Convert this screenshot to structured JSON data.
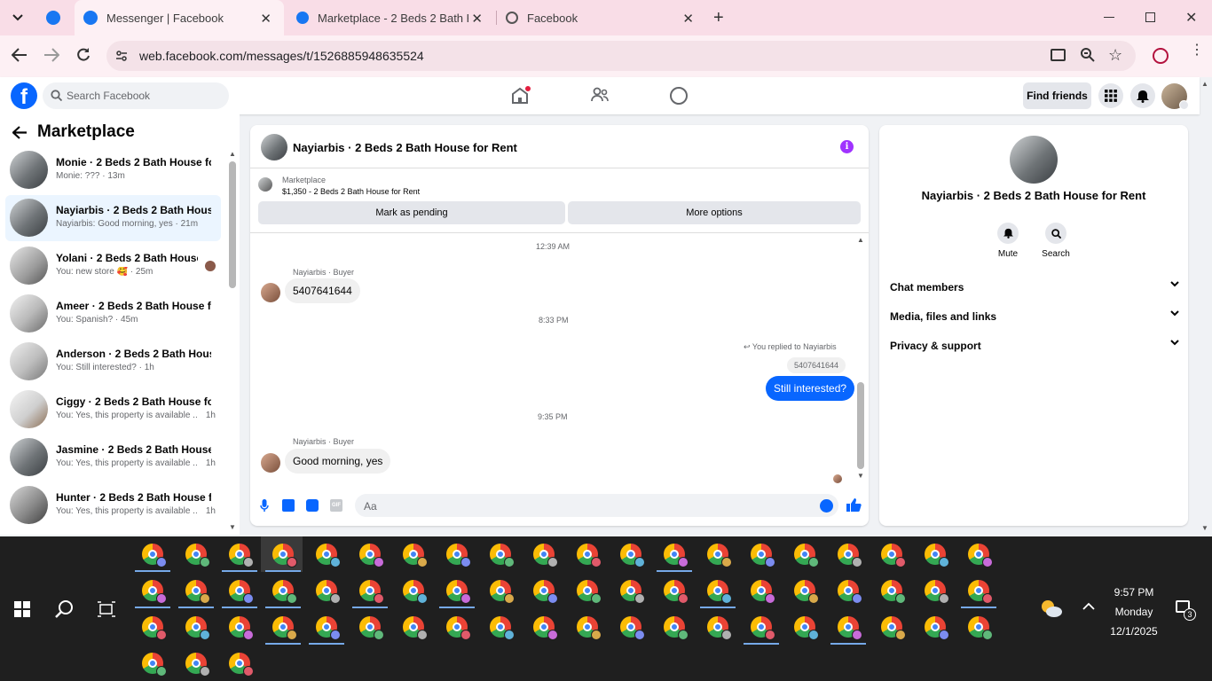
{
  "browser": {
    "tabs": [
      {
        "title": "Messenger | Facebook",
        "active": true
      },
      {
        "title": "Marketplace - 2 Beds 2 Bath Ho",
        "active": false
      },
      {
        "title": "Facebook",
        "active": false
      }
    ],
    "url": "web.facebook.com/messages/t/1526885948635524"
  },
  "fb_header": {
    "search_placeholder": "Search Facebook",
    "find_friends": "Find friends"
  },
  "sidebar": {
    "title": "Marketplace",
    "items": [
      {
        "name": "Monie · 2 Beds 2 Bath House fo...",
        "preview": "Monie: ??? · 13m",
        "time": ""
      },
      {
        "name": "Nayiarbis · 2 Beds 2 Bath House...",
        "preview": "Nayiarbis: Good morning, yes · 21m",
        "time": ""
      },
      {
        "name": "Yolani · 2 Beds 2 Bath House ...",
        "preview": "You: new store 🥰 · 25m",
        "time": ""
      },
      {
        "name": "Ameer · 2 Beds 2 Bath House fo...",
        "preview": "You: Spanish? · 45m",
        "time": ""
      },
      {
        "name": "Anderson · 2 Beds 2 Bath Hous...",
        "preview": "You: Still interested? · 1h",
        "time": ""
      },
      {
        "name": "Ciggy · 2 Beds 2 Bath House for...",
        "preview": "You: Yes, this property is available ...",
        "time": "1h"
      },
      {
        "name": "Jasmine · 2 Beds 2 Bath House f...",
        "preview": "You: Yes, this property is available ...",
        "time": "1h"
      },
      {
        "name": "Hunter · 2 Beds 2 Bath House f...",
        "preview": "You: Yes, this property is available ...",
        "time": "1h"
      }
    ]
  },
  "chat": {
    "title": "Nayiarbis · 2 Beds 2 Bath House for Rent",
    "listing_source": "Marketplace",
    "listing": "$1,350 - 2 Beds 2 Bath House for Rent",
    "mark_pending": "Mark as pending",
    "more_options": "More options",
    "messages": {
      "ts1": "12:39 AM",
      "sender1": "Nayiarbis · Buyer",
      "msg1": "5407641644",
      "ts2": "8:33 PM",
      "replied": "You replied to Nayiarbis",
      "quoted": "5407641644",
      "msg2": "Still interested?",
      "ts3": "9:35 PM",
      "sender2": "Nayiarbis · Buyer",
      "msg3": "Good morning, yes"
    },
    "composer_placeholder": "Aa"
  },
  "details": {
    "name": "Nayiarbis · 2 Beds 2 Bath House for Rent",
    "mute": "Mute",
    "search": "Search",
    "sections": [
      "Chat members",
      "Media, files and links",
      "Privacy & support"
    ]
  },
  "taskbar": {
    "time": "9:57 PM",
    "day": "Monday",
    "date": "12/1/2025",
    "notif_count": "3"
  },
  "colors": {
    "fb_blue": "#0866ff",
    "accent_purple": "#a033ff",
    "tab_bg": "#f9dde7"
  }
}
